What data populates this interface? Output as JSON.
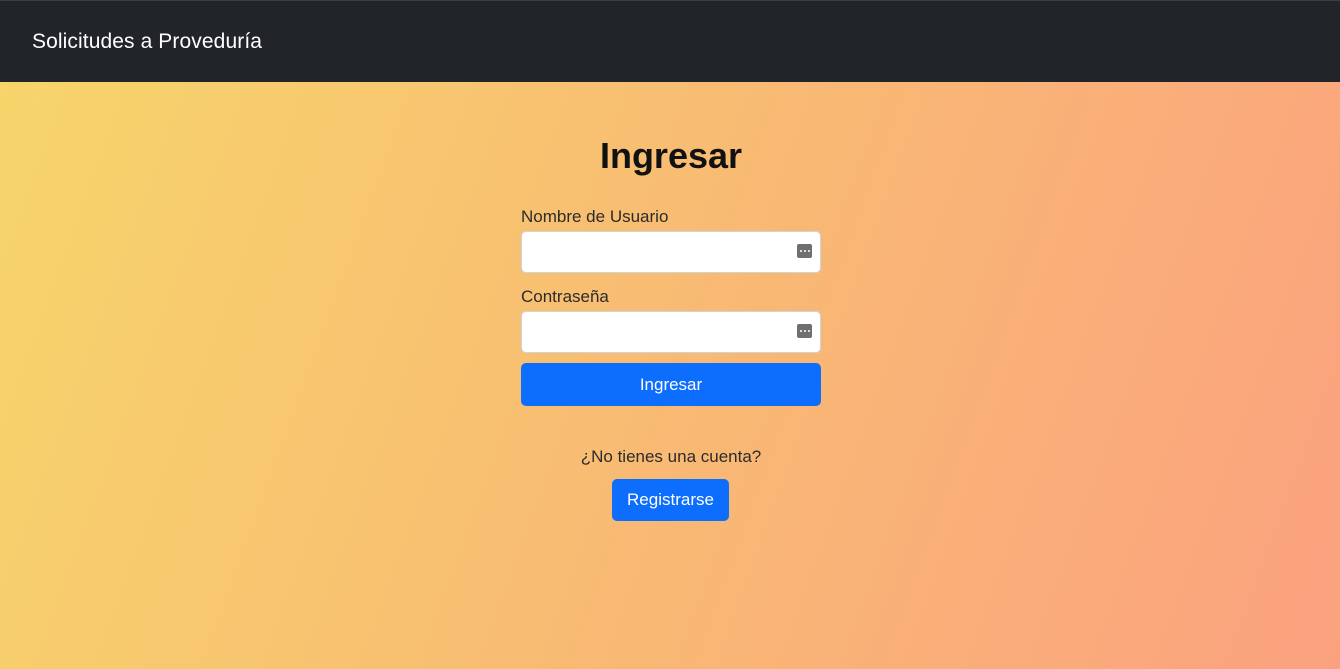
{
  "navbar": {
    "brand": "Solicitudes a Proveduría"
  },
  "login": {
    "title": "Ingresar",
    "username_label": "Nombre de Usuario",
    "username_value": "",
    "password_label": "Contraseña",
    "password_value": "",
    "submit_label": "Ingresar",
    "no_account_text": "¿No tienes una cuenta?",
    "register_label": "Registrarse",
    "field_icon": "password-manager-icon"
  },
  "colors": {
    "navbar_bg": "#212529",
    "primary": "#0d6efd",
    "gradient_start": "#f7d56b",
    "gradient_end": "#fba17f"
  }
}
